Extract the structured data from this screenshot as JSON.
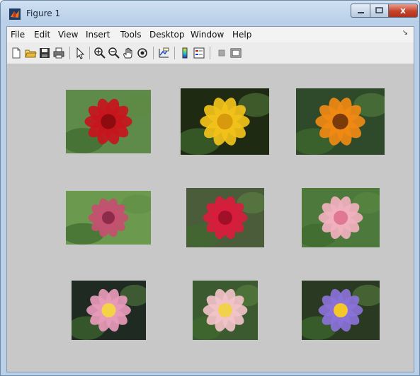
{
  "window": {
    "title": "Figure 1",
    "close_label": "x"
  },
  "menu": {
    "items": [
      "File",
      "Edit",
      "View",
      "Insert",
      "Tools",
      "Desktop",
      "Window",
      "Help"
    ],
    "more_arrow": "↘"
  },
  "toolbar": {
    "icons": [
      "new-figure-icon",
      "open-file-icon",
      "save-icon",
      "print-icon",
      "pointer-icon",
      "zoom-in-icon",
      "zoom-out-icon",
      "pan-hand-icon",
      "rotate-3d-icon",
      "data-cursor-icon",
      "colorbar-icon",
      "legend-icon",
      "hide-plot-tools-icon",
      "show-plot-tools-icon"
    ]
  },
  "images": [
    {
      "subject": "red rose",
      "bg": "#5e8a4a",
      "flower": "#c8151d",
      "accent": "#8e0c10"
    },
    {
      "subject": "yellow rose",
      "bg": "#1f2a12",
      "flower": "#f2c21a",
      "accent": "#d89a0c"
    },
    {
      "subject": "orange gazania",
      "bg": "#2f4a2a",
      "flower": "#f08a14",
      "accent": "#7a3a0a"
    },
    {
      "subject": "pink rose",
      "bg": "#6b9a4f",
      "flower": "#c45070",
      "accent": "#8f2b4a"
    },
    {
      "subject": "red roses",
      "bg": "#4a5c3a",
      "flower": "#d91c3c",
      "accent": "#a01028"
    },
    {
      "subject": "pink lotus",
      "bg": "#4d7a3c",
      "flower": "#f1b0be",
      "accent": "#e07894"
    },
    {
      "subject": "pink water lily",
      "bg": "#1e2a22",
      "flower": "#e89ab8",
      "accent": "#f3d447"
    },
    {
      "subject": "pink lotus 2",
      "bg": "#3c5a30",
      "flower": "#f2c2c8",
      "accent": "#f1d24a"
    },
    {
      "subject": "purple water lily",
      "bg": "#2a3a22",
      "flower": "#8a72d8",
      "accent": "#f5c82a"
    }
  ]
}
